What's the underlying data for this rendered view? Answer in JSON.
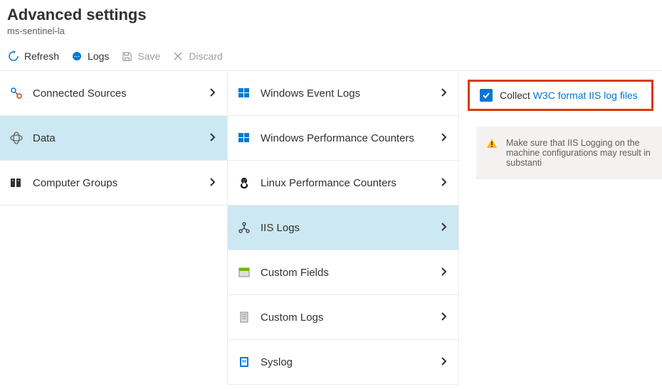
{
  "header": {
    "title": "Advanced settings",
    "subtitle": "ms-sentinel-la"
  },
  "toolbar": {
    "refresh": "Refresh",
    "logs": "Logs",
    "save": "Save",
    "discard": "Discard"
  },
  "col1": {
    "items": [
      {
        "label": "Connected Sources"
      },
      {
        "label": "Data"
      },
      {
        "label": "Computer Groups"
      }
    ],
    "selected": 1
  },
  "col2": {
    "items": [
      {
        "label": "Windows Event Logs"
      },
      {
        "label": "Windows Performance Counters"
      },
      {
        "label": "Linux Performance Counters"
      },
      {
        "label": "IIS Logs"
      },
      {
        "label": "Custom Fields"
      },
      {
        "label": "Custom Logs"
      },
      {
        "label": "Syslog"
      }
    ],
    "selected": 3
  },
  "detail": {
    "checkbox_checked": true,
    "prefix": "Collect ",
    "link": "W3C format IIS log files",
    "warning": "Make sure that IIS Logging on the machine configurations may result in substanti"
  }
}
